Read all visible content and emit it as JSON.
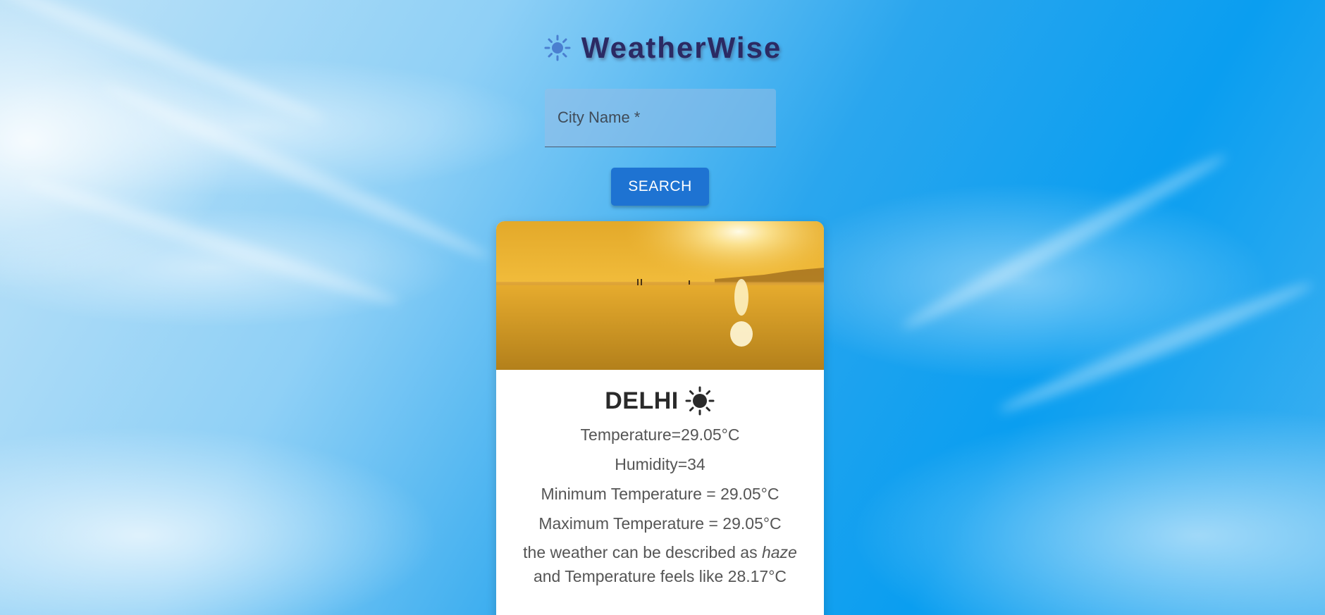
{
  "app": {
    "title": "WeatherWise",
    "icon": "sun-icon",
    "accent_color": "#1e73d2",
    "title_color": "#2b2a63"
  },
  "search": {
    "placeholder": "City Name *",
    "value": "",
    "button_label": "SEARCH"
  },
  "result": {
    "city": "DELHI",
    "condition_icon": "sun-icon",
    "temperature": "Temperature=29.05°C",
    "humidity": "Humidity=34",
    "min_temperature": "Minimum Temperature = 29.05°C",
    "max_temperature": "Maximum Temperature = 29.05°C",
    "description_prefix": "the weather can be described as",
    "description_value": "haze",
    "feels_like": "and Temperature feels like 28.17°C"
  }
}
